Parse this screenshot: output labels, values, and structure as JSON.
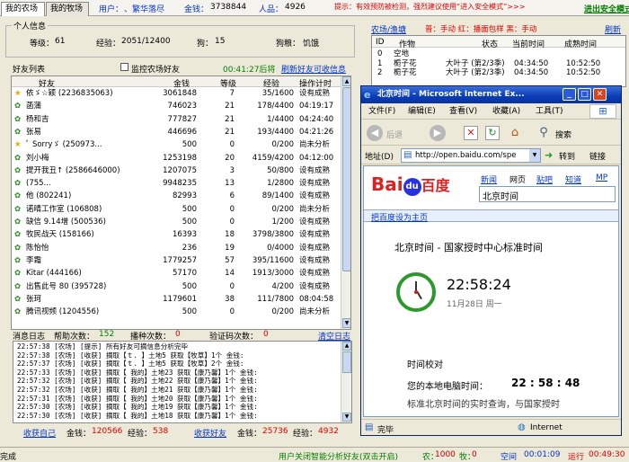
{
  "tabs": {
    "my_farm": "我的农场",
    "my_ranch": "我的牧场"
  },
  "header": {
    "user_label": "用户：",
    "user_name": "、繁华落尽",
    "gold_label": "金钱：",
    "gold_value": "3738844",
    "rep_label": "人品：",
    "rep_value": "4926",
    "notice": "提示：有效预防被检测，强烈建议使用“进入安全模式”>>>",
    "safe_mode": "进出安全模式"
  },
  "personal": {
    "title": "个人信息",
    "level_label": "等级：",
    "level": "61",
    "exp_label": "经验：",
    "exp": "2051/12400",
    "dog_label": "狗：",
    "dog": "15",
    "dogfood_label": "狗粮：",
    "dogfood": "饥饿"
  },
  "friends": {
    "title": "好友列表",
    "monitor_label": "监控农场好友",
    "countdown": "00:41:27后将",
    "refresh_link": "刷新好友可收信息",
    "columns": [
      "好友",
      "金钱",
      "等级",
      "经验",
      "操作计时"
    ],
    "rows": [
      {
        "icon": "star",
        "name": "依ゞ☆颖 (2236835063)",
        "gold": "3061848",
        "level": "7",
        "exp": "35/1600",
        "status": "设有成熟"
      },
      {
        "icon": "leaf",
        "name": "菡蒲",
        "gold": "746023",
        "level": "21",
        "exp": "178/4400",
        "status": "04:19:17"
      },
      {
        "icon": "leaf",
        "name": "杨和吉",
        "gold": "777827",
        "level": "21",
        "exp": "1/4400",
        "status": "04:24:40"
      },
      {
        "icon": "leaf",
        "name": "张易",
        "gold": "446696",
        "level": "21",
        "exp": "193/4400",
        "status": "04:21:26"
      },
      {
        "icon": "star",
        "name": "ﾟ Sorryゞ (250973...",
        "gold": "500",
        "level": "0",
        "exp": "0/200",
        "status": "尚未分析"
      },
      {
        "icon": "leaf",
        "name": "刘小梅",
        "gold": "1253198",
        "level": "20",
        "exp": "4159/4200",
        "status": "04:12:00"
      },
      {
        "icon": "leaf",
        "name": "提开我丑↑ (2586646000)",
        "gold": "1207075",
        "level": "3",
        "exp": "50/800",
        "status": "设有成熟"
      },
      {
        "icon": "leaf",
        "name": "(755...",
        "gold": "9948235",
        "level": "13",
        "exp": "1/2800",
        "status": "设有成熟"
      },
      {
        "icon": "leaf",
        "name": "他 (802241)",
        "gold": "82993",
        "level": "6",
        "exp": "89/1400",
        "status": "设有成熟"
      },
      {
        "icon": "leaf",
        "name": "诺晴工作室 (106808)",
        "gold": "500",
        "level": "0",
        "exp": "0/200",
        "status": "尚未分析"
      },
      {
        "icon": "leaf",
        "name": "缺信 9.14增 (500536)",
        "gold": "500",
        "level": "0",
        "exp": "1/200",
        "status": "设有成熟"
      },
      {
        "icon": "leaf",
        "name": "牧民战天 (158166)",
        "gold": "16393",
        "level": "18",
        "exp": "3798/3800",
        "status": "设有成熟"
      },
      {
        "icon": "leaf",
        "name": "陈怡怡",
        "gold": "236",
        "level": "19",
        "exp": "0/4000",
        "status": "设有成熟"
      },
      {
        "icon": "leaf",
        "name": "李霜",
        "gold": "1779257",
        "level": "57",
        "exp": "395/11600",
        "status": "设有成熟"
      },
      {
        "icon": "leaf",
        "name": "Kitar (444166)",
        "gold": "57170",
        "level": "14",
        "exp": "1913/3000",
        "status": "设有成熟"
      },
      {
        "icon": "leaf",
        "name": "出售此号 80 (395728)",
        "gold": "500",
        "level": "0",
        "exp": "4/200",
        "status": "设有成熟"
      },
      {
        "icon": "leaf",
        "name": "张珂",
        "gold": "1179601",
        "level": "38",
        "exp": "111/7800",
        "status": "08:04:58"
      },
      {
        "icon": "leaf",
        "name": "腾讯视频 (1204556)",
        "gold": "500",
        "level": "0",
        "exp": "0/200",
        "status": "尚未分析"
      }
    ]
  },
  "log": {
    "title": "消息日志",
    "help_label": "帮助次数：",
    "help": "152",
    "sow_label": "播种次数：",
    "sow": "0",
    "verify_label": "验证码次数：",
    "verify": "0",
    "clear": "清空日志",
    "lines": [
      "22:57:38 [农场] [提示] 所有好友可摘信息分析完毕",
      "22:57:38 [农场] [收获] 摘取【ｔ.          】土地5 获取【牧草】1个 金钱:",
      "22:57:37 [农场] [收获] 摘取【ｔ.          】土地5 获取【牧草】2个 金钱:",
      "22:57:33 [农场] [收获] 摘取【          我的】土地23 获取【康乃馨】1个 金钱:",
      "22:57:32 [农场] [收获] 摘取【          我的】土地22 获取【康乃馨】1个 金钱:",
      "22:57:32 [农场] [收获] 摘取【          我的】土地21 获取【康乃馨】1个 金钱:",
      "22:57:31 [农场] [收获] 摘取【          我的】土地20 获取【康乃馨】1个 金钱:",
      "22:57:30 [农场] [收获] 摘取【          我的】土地19 获取【康乃馨】1个 金钱:",
      "22:57:30 [农场] [收获] 摘取【          我的】土地18 获取【康乃馨】1个 金钱:"
    ],
    "harvest_self": "收获自己",
    "gold_label": "金钱：",
    "self_gold": "120566",
    "exp_label": "经验：",
    "self_exp": "538",
    "harvest_friends": "收获好友",
    "friends_gold": "25736",
    "friends_exp": "4932"
  },
  "market": {
    "title": "农场/渔塘",
    "legend": "普：手动  红：播面包样  黑：手动",
    "refresh": "刷新",
    "columns": [
      "ID",
      "作物",
      "状态",
      "当前时间",
      "成熟时间"
    ],
    "rows": [
      {
        "id": "0",
        "crop": "空地",
        "state": "",
        "now": "",
        "ripe": ""
      },
      {
        "id": "1",
        "crop": "栀子花",
        "state": "大叶子 (第2/3季)",
        "now": "04:34:50",
        "ripe": "10:52:50"
      },
      {
        "id": "2",
        "crop": "栀子花",
        "state": "大叶子 (第2/3季)",
        "now": "04:34:50",
        "ripe": "10:52:50"
      }
    ]
  },
  "status": {
    "left": "完成",
    "center": "用户关闭智能分析好友(双击开启)",
    "farm_label": "农：",
    "farm": "1000",
    "ranch_label": "牧：",
    "ranch": "0",
    "space_label": "空间",
    "space_time": "00:01:09",
    "run_label": "运行",
    "run_time": "00:49:30"
  },
  "ie": {
    "title": "北京时间 - Microsoft Internet Ex...",
    "menu": [
      "文件(F)",
      "编辑(E)",
      "查看(V)",
      "收藏(A)",
      "工具(T)"
    ],
    "back": "后退",
    "search": "搜索",
    "address_label": "地址(D)",
    "url": "http://open.baidu.com/spe",
    "go": "转到",
    "links": "链接",
    "baidu_nav": [
      "新闻",
      "网页",
      "贴吧",
      "知道",
      "MP"
    ],
    "search_query": "北京时间",
    "set_home": "把百度设为主页",
    "heading": "北京时间 - 国家授时中心标准时间",
    "clock_time": "22:58:24",
    "clock_date": "11月28日  周一",
    "calib_title": "时间校对",
    "local_label": "您的本地电脑时间：",
    "local_time": "22 : 58 : 48",
    "partial_line": "标准北京时间的实时查询，与国家授时",
    "status_done": "完毕",
    "zone": "Internet"
  }
}
